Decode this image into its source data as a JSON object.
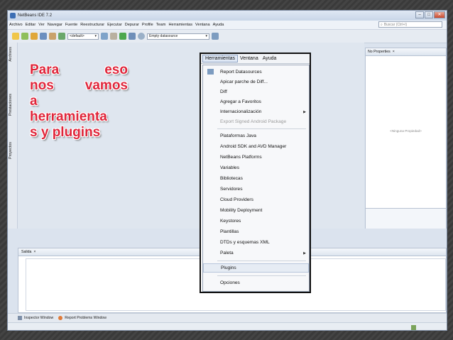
{
  "window": {
    "title": "NetBeans IDE 7.2"
  },
  "menubar": {
    "items": [
      "Archivo",
      "Editar",
      "Ver",
      "Navegar",
      "Fuente",
      "Reestructurar",
      "Ejecutar",
      "Depurar",
      "Profile",
      "Team",
      "Herramientas",
      "Ventana",
      "Ayuda"
    ],
    "search_placeholder": "Buscar (Ctrl+I)"
  },
  "toolbar": {
    "config_select": "<default>",
    "datasource_select": "Empty datasource"
  },
  "side_tabs": [
    "Archivos",
    "Prestaciones",
    "Proyectos"
  ],
  "properties": {
    "title": "No Properties",
    "empty_text": "<Ninguna Propiedad>"
  },
  "output": {
    "title": "Salida"
  },
  "bottom_tabs": [
    "Inspector Window",
    "Report Problems Window"
  ],
  "annotation": {
    "lines": [
      "Para eso",
      "nos vamos",
      "a",
      "herramienta",
      "s y plugins"
    ]
  },
  "menu": {
    "header": [
      "Herramientas",
      "Ventana",
      "Ayuda"
    ],
    "items": [
      {
        "label": "Report Datasources",
        "state": "normal"
      },
      {
        "label": "Apicar parche de Diff...",
        "state": "normal"
      },
      {
        "label": "Diff",
        "state": "normal"
      },
      {
        "label": "Agregar a Favoritos",
        "state": "normal"
      },
      {
        "label": "Internacionalización",
        "state": "submenu"
      },
      {
        "label": "Export Signed Android Package",
        "state": "disabled"
      },
      {
        "label": "Plataformas Java",
        "state": "normal"
      },
      {
        "label": "Android SDK and AVD Manager",
        "state": "normal"
      },
      {
        "label": "NetBeans Platforms",
        "state": "normal"
      },
      {
        "label": "Variables",
        "state": "normal"
      },
      {
        "label": "Bibliotecas",
        "state": "normal"
      },
      {
        "label": "Servidores",
        "state": "normal"
      },
      {
        "label": "Cloud Providers",
        "state": "normal"
      },
      {
        "label": "Mobility Deployment",
        "state": "normal"
      },
      {
        "label": "Keystores",
        "state": "normal"
      },
      {
        "label": "Plantillas",
        "state": "normal"
      },
      {
        "label": "DTDs y esquemas XML",
        "state": "normal"
      },
      {
        "label": "Paleta",
        "state": "submenu"
      },
      {
        "label": "Plugins",
        "state": "highlighted"
      },
      {
        "label": "Opciones",
        "state": "normal"
      }
    ]
  }
}
